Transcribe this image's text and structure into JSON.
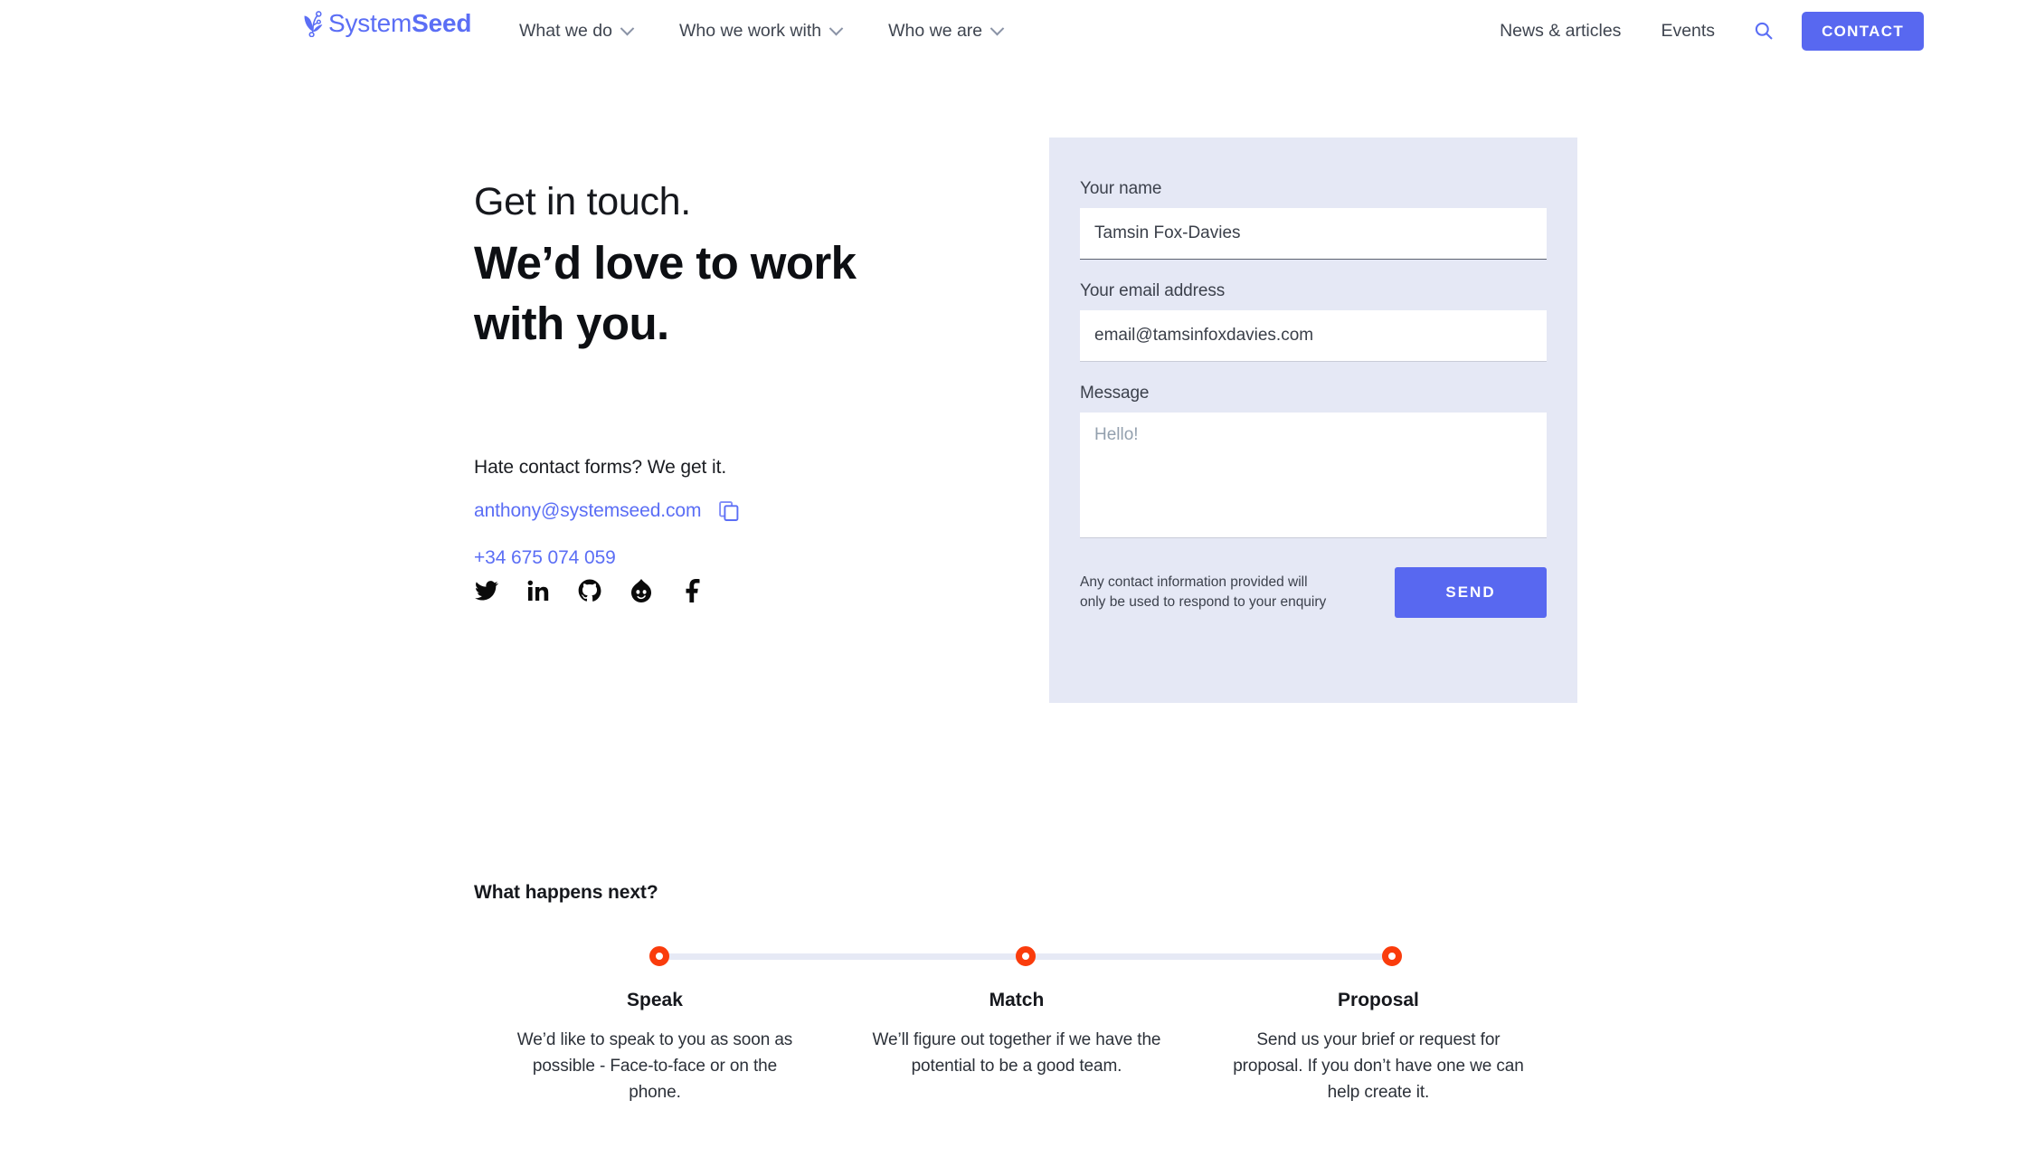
{
  "brand": {
    "name_light": "System",
    "name_bold": "Seed",
    "logo_icon": "systemseed-sprout-logo",
    "color": "#5b6ef5"
  },
  "header": {
    "nav_items": [
      {
        "label": "What we do",
        "has_dropdown": true
      },
      {
        "label": "Who we work with",
        "has_dropdown": true
      },
      {
        "label": "Who we are",
        "has_dropdown": true
      }
    ],
    "right_links": [
      {
        "label": "News & articles"
      },
      {
        "label": "Events"
      }
    ],
    "search_icon": "search-icon",
    "contact_button": "CONTACT",
    "contact_button_color": "#5868f0"
  },
  "hero": {
    "kicker": "Get in touch.",
    "headline": "We’d love to work with you.",
    "hate_forms": "Hate contact forms? We get it.",
    "email": "anthony@systemseed.com",
    "copy_icon": "copy-icon",
    "phone": "+34 675 074 059",
    "link_color": "#5b6ef5",
    "socials": [
      {
        "name": "twitter",
        "icon": "twitter-icon"
      },
      {
        "name": "linkedin",
        "icon": "linkedin-icon"
      },
      {
        "name": "github",
        "icon": "github-icon"
      },
      {
        "name": "drupal",
        "icon": "drupal-icon"
      },
      {
        "name": "facebook",
        "icon": "facebook-icon"
      }
    ]
  },
  "form": {
    "panel_color": "#e5e8f5",
    "name": {
      "label": "Your name",
      "value": "Tamsin Fox-Davies",
      "placeholder": "Your name"
    },
    "email": {
      "label": "Your email address",
      "value": "email@tamsinfoxdavies.com",
      "placeholder": "Your email address"
    },
    "message": {
      "label": "Message",
      "value": "",
      "placeholder": "Hello!"
    },
    "privacy_note": "Any contact information provided will only be used to respond to your enquiry",
    "send_label": "SEND",
    "send_color": "#5868f0"
  },
  "next": {
    "title": "What happens next?",
    "dot_color": "#fa3c0c",
    "line_color": "#e6e9f5",
    "steps": [
      {
        "title": "Speak",
        "desc": "We’d like to speak to you as soon as possible - Face-to-face or on the phone."
      },
      {
        "title": "Match",
        "desc": "We’ll figure out together if we have the potential to be a good team."
      },
      {
        "title": "Proposal",
        "desc": "Send us your brief or request for proposal. If you don’t have one we can help create it."
      }
    ]
  }
}
